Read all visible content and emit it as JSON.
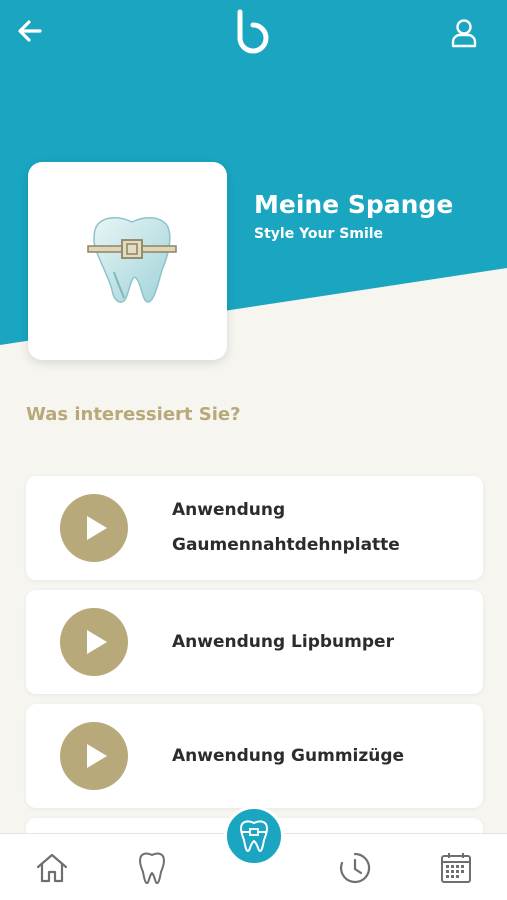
{
  "colors": {
    "brand_blue": "#1aa5c1",
    "accent_gold": "#b8a97a",
    "background": "#f6f5f0"
  },
  "topbar": {
    "back_icon": "arrow-left-icon",
    "logo_icon": "brand-logo-icon",
    "profile_icon": "user-icon"
  },
  "hero": {
    "title": "Meine Spange",
    "subtitle": "Style Your Smile",
    "image_icon": "tooth-with-braces-icon"
  },
  "section": {
    "heading": "Was interessiert Sie?"
  },
  "items": [
    {
      "label": "Anwendung Gaumennahtdehnplatte",
      "icon": "play-icon"
    },
    {
      "label": "Anwendung Lipbumper",
      "icon": "play-icon"
    },
    {
      "label": "Anwendung Gummizüge",
      "icon": "play-icon"
    }
  ],
  "bottom_nav": [
    {
      "icon": "home-icon",
      "active": false
    },
    {
      "icon": "tooth-icon",
      "active": false
    },
    {
      "icon": "braces-tooth-icon",
      "active": true
    },
    {
      "icon": "history-clock-icon",
      "active": false
    },
    {
      "icon": "calendar-icon",
      "active": false
    }
  ]
}
